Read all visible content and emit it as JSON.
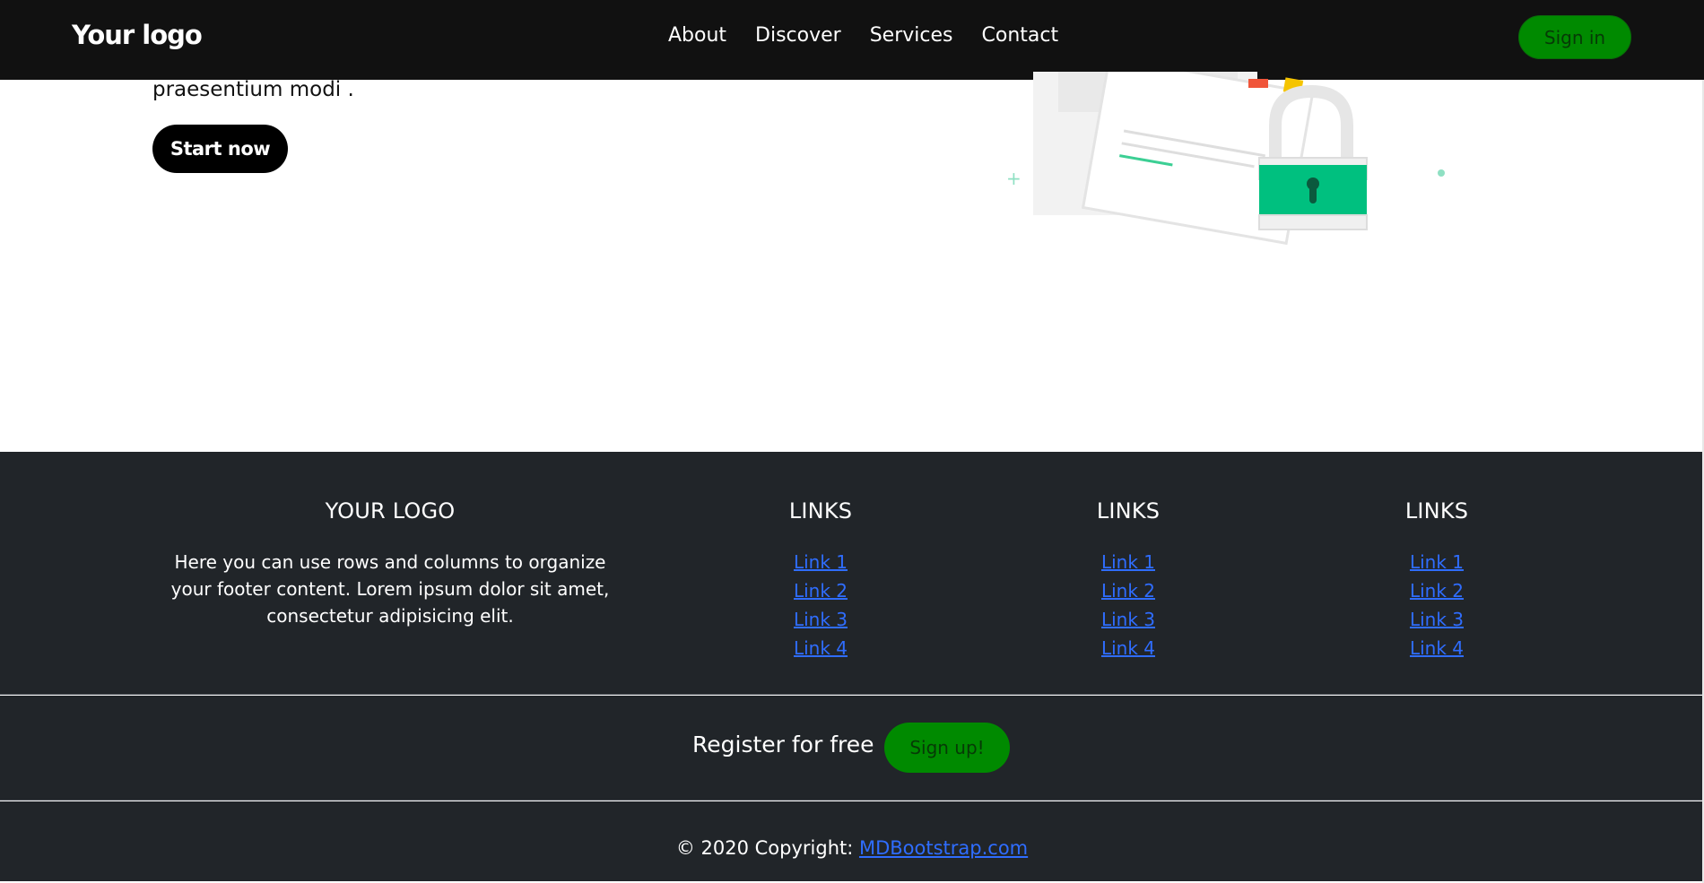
{
  "navbar": {
    "logo": "Your logo",
    "links": [
      "About",
      "Discover",
      "Services",
      "Contact"
    ],
    "signin_label": "Sign in"
  },
  "hero": {
    "text": "praesentium modi .",
    "cta_label": "Start now"
  },
  "colors": {
    "nav_bg": "#111111",
    "footer_bg": "#212529",
    "accent_green": "#008a00",
    "link_blue": "#2f6dff",
    "illustration_green": "#00c07f"
  },
  "footer": {
    "logo_title": "YOUR LOGO",
    "description": "Here you can use rows and columns to organize your footer content. Lorem ipsum dolor sit amet, consectetur adipisicing elit.",
    "columns": [
      {
        "title": "LINKS",
        "links": [
          "Link 1",
          "Link 2",
          "Link 3",
          "Link 4"
        ]
      },
      {
        "title": "LINKS",
        "links": [
          "Link 1",
          "Link 2",
          "Link 3",
          "Link 4"
        ]
      },
      {
        "title": "LINKS",
        "links": [
          "Link 1",
          "Link 2",
          "Link 3",
          "Link 4"
        ]
      }
    ],
    "register_label": "Register for free",
    "signup_label": "Sign up!",
    "copyright_prefix": "© 2020 Copyright:",
    "copyright_link": "MDBootstrap.com"
  },
  "icons": {
    "illustration": "document-lock-illustration",
    "lock": "padlock-icon"
  }
}
